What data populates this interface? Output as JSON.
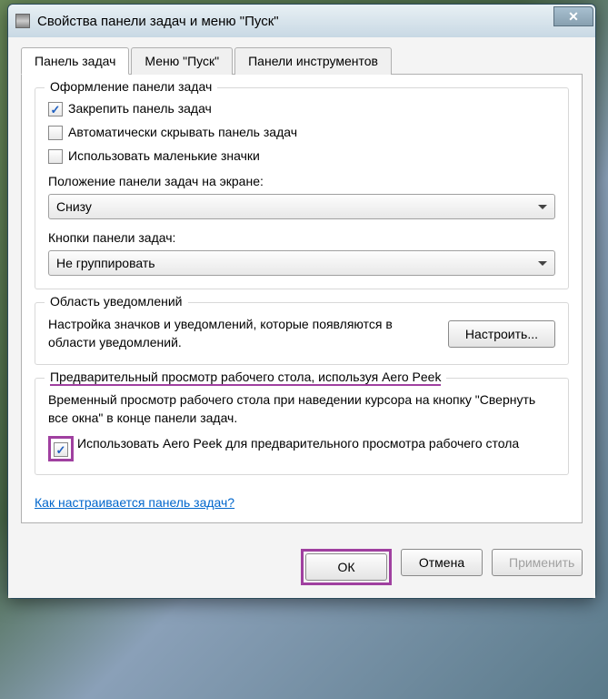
{
  "titlebar": {
    "title": "Свойства панели задач и меню \"Пуск\""
  },
  "tabs": {
    "taskbar": "Панель задач",
    "startmenu": "Меню \"Пуск\"",
    "toolbars": "Панели инструментов"
  },
  "appearance": {
    "legend": "Оформление панели задач",
    "lock": "Закрепить панель задач",
    "autohide": "Автоматически скрывать панель задач",
    "smallicons": "Использовать маленькие значки",
    "position_label": "Положение панели задач на экране:",
    "position_value": "Снизу",
    "buttons_label": "Кнопки панели задач:",
    "buttons_value": "Не группировать"
  },
  "notify": {
    "legend": "Область уведомлений",
    "text": "Настройка значков и уведомлений, которые появляются в области уведомлений.",
    "button": "Настроить..."
  },
  "aero": {
    "legend": "Предварительный просмотр рабочего стола, используя Aero Peek",
    "desc": "Временный просмотр рабочего стола при наведении курсора на кнопку \"Свернуть все окна\" в конце панели задач.",
    "check": "Использовать Aero Peek для предварительного просмотра рабочего стола"
  },
  "link": "Как настраивается панель задач?",
  "buttons": {
    "ok": "ОК",
    "cancel": "Отмена",
    "apply": "Применить"
  }
}
